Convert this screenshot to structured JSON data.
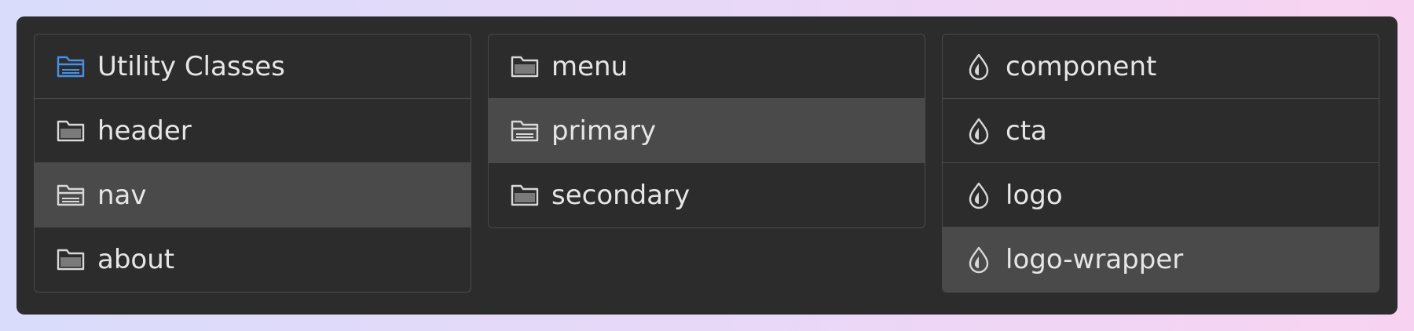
{
  "columns": [
    {
      "items": [
        {
          "label": "Utility Classes",
          "icon": "folder-open-icon",
          "icon_color": "#4a90e2",
          "selected": false
        },
        {
          "label": "header",
          "icon": "folder-icon",
          "selected": false
        },
        {
          "label": "nav",
          "icon": "folder-open-icon",
          "selected": true
        },
        {
          "label": "about",
          "icon": "folder-icon",
          "selected": false
        }
      ]
    },
    {
      "items": [
        {
          "label": "menu",
          "icon": "folder-icon",
          "selected": false
        },
        {
          "label": "primary",
          "icon": "folder-open-icon",
          "selected": true
        },
        {
          "label": "secondary",
          "icon": "folder-icon",
          "selected": false
        }
      ]
    },
    {
      "items": [
        {
          "label": "component",
          "icon": "drop-icon",
          "selected": false
        },
        {
          "label": "cta",
          "icon": "drop-icon",
          "selected": false
        },
        {
          "label": "logo",
          "icon": "drop-icon",
          "selected": false
        },
        {
          "label": "logo-wrapper",
          "icon": "drop-icon",
          "selected": true
        }
      ]
    }
  ],
  "colors": {
    "panel_bg": "#2c2c2c",
    "row_selected_bg": "#4a4a4a",
    "border": "#4a4a4a",
    "text": "#e6e6e6",
    "icon_default": "#d8d8d8",
    "icon_accent": "#4a90e2"
  }
}
